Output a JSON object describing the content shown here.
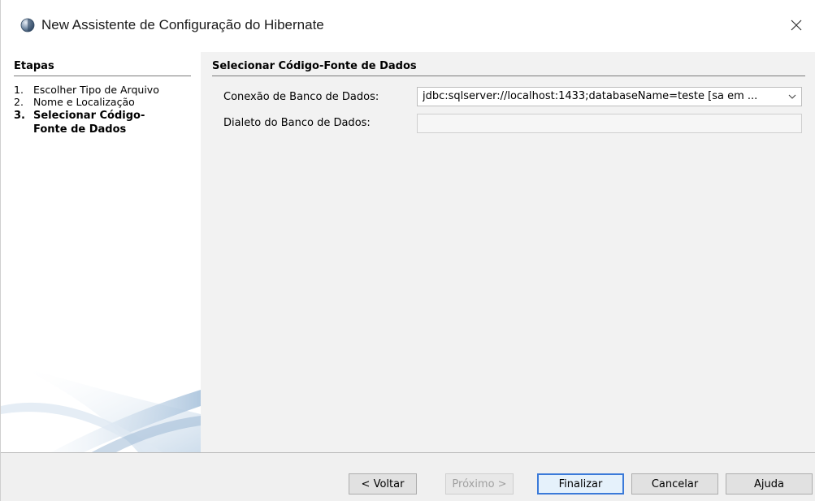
{
  "window": {
    "title": "New Assistente de Configuração do Hibernate",
    "close_glyph": "✕"
  },
  "steps": {
    "title": "Etapas",
    "items": [
      {
        "number": "1.",
        "label": "Escolher Tipo de Arquivo"
      },
      {
        "number": "2.",
        "label": "Nome e Localização"
      },
      {
        "number": "3.",
        "label": "Selecionar Código-Fonte de Dados"
      }
    ],
    "current_index": 2
  },
  "content": {
    "title": "Selecionar Código-Fonte de Dados",
    "connection_label": "Conexão de Banco de Dados:",
    "connection_value": "jdbc:sqlserver://localhost:1433;databaseName=teste [sa em ...",
    "dialect_label": "Dialeto do Banco de Dados:",
    "dialect_value": ""
  },
  "buttons": {
    "back": "< Voltar",
    "next": "Próximo >",
    "finish": "Finalizar",
    "cancel": "Cancelar",
    "help": "Ajuda"
  },
  "icons": {
    "app": "hibernate-app-icon",
    "close": "close-icon",
    "dropdown": "chevron-down-icon"
  },
  "colors": {
    "accent": "#3b7ad9",
    "panel_bg": "#f2f2f2"
  }
}
